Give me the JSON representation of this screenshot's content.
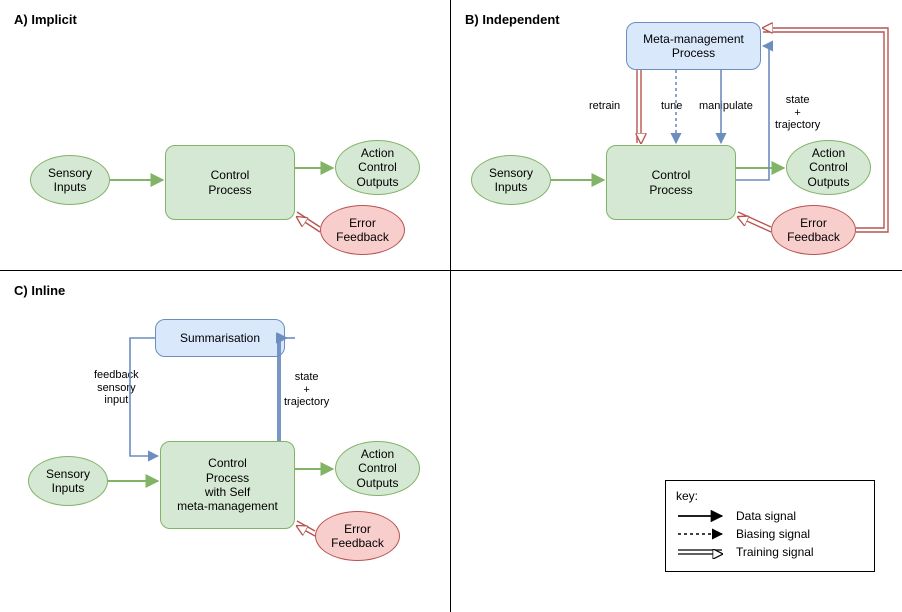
{
  "panels": {
    "a": {
      "title": "A) Implicit"
    },
    "b": {
      "title": "B) Independent"
    },
    "c": {
      "title": "C) Inline"
    }
  },
  "nodes": {
    "sensory_inputs": "Sensory\nInputs",
    "control_process": "Control\nProcess",
    "action_outputs": "Action\nControl\nOutputs",
    "error_feedback": "Error\nFeedback",
    "meta_management": "Meta-management\nProcess",
    "summarisation": "Summarisation",
    "control_process_self": "Control\nProcess\nwith Self\nmeta-management"
  },
  "edge_labels": {
    "retrain": "retrain",
    "tune": "tune",
    "manipulate": "manipulate",
    "state_traj": "state\n+\ntrajectory",
    "feedback_sensory_input": "feedback\nsensory\ninput"
  },
  "key": {
    "heading": "key:",
    "data_signal": "Data signal",
    "biasing_signal": "Biasing signal",
    "training_signal": "Training signal"
  },
  "colors": {
    "green_stroke": "#82b366",
    "green_fill": "#d5e8d4",
    "blue_stroke": "#6c8ebf",
    "blue_fill": "#dae8fc",
    "red_stroke": "#b85450",
    "pink_fill": "#f8cecc",
    "black": "#000000"
  }
}
